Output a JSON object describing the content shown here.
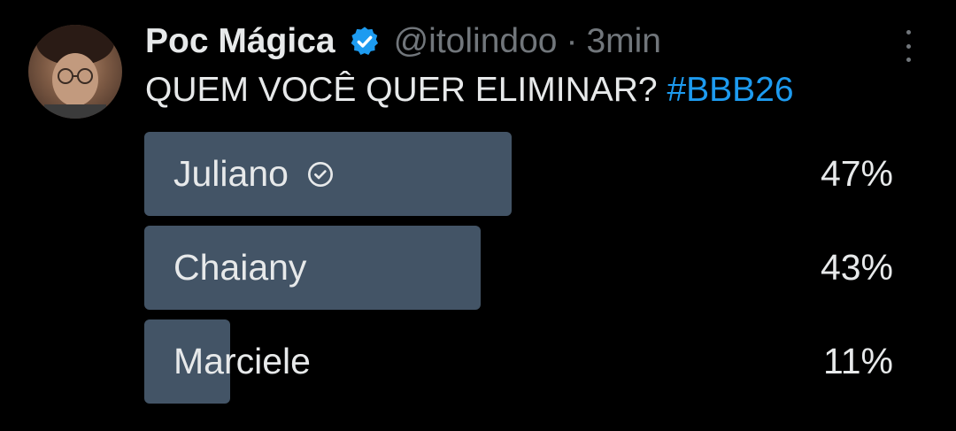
{
  "tweet": {
    "display_name": "Poc Mágica",
    "handle": "@itolindoo",
    "separator": "·",
    "time": "3min",
    "verified_icon": "verified-badge-icon",
    "text": "QUEM VOCÊ QUER ELIMINAR?",
    "hashtag": "#BBB26"
  },
  "poll": {
    "options": [
      {
        "label": "Juliano",
        "percent": "47%",
        "fill": 0.47,
        "selected": true
      },
      {
        "label": "Chaiany",
        "percent": "43%",
        "fill": 0.43,
        "selected": false
      },
      {
        "label": "Marciele",
        "percent": "11%",
        "fill": 0.11,
        "selected": false
      }
    ]
  },
  "colors": {
    "background": "#000000",
    "text": "#e7e9ea",
    "muted": "#71767b",
    "link": "#1d9bf0",
    "poll_bar": "#435466",
    "verified": "#1d9bf0"
  }
}
